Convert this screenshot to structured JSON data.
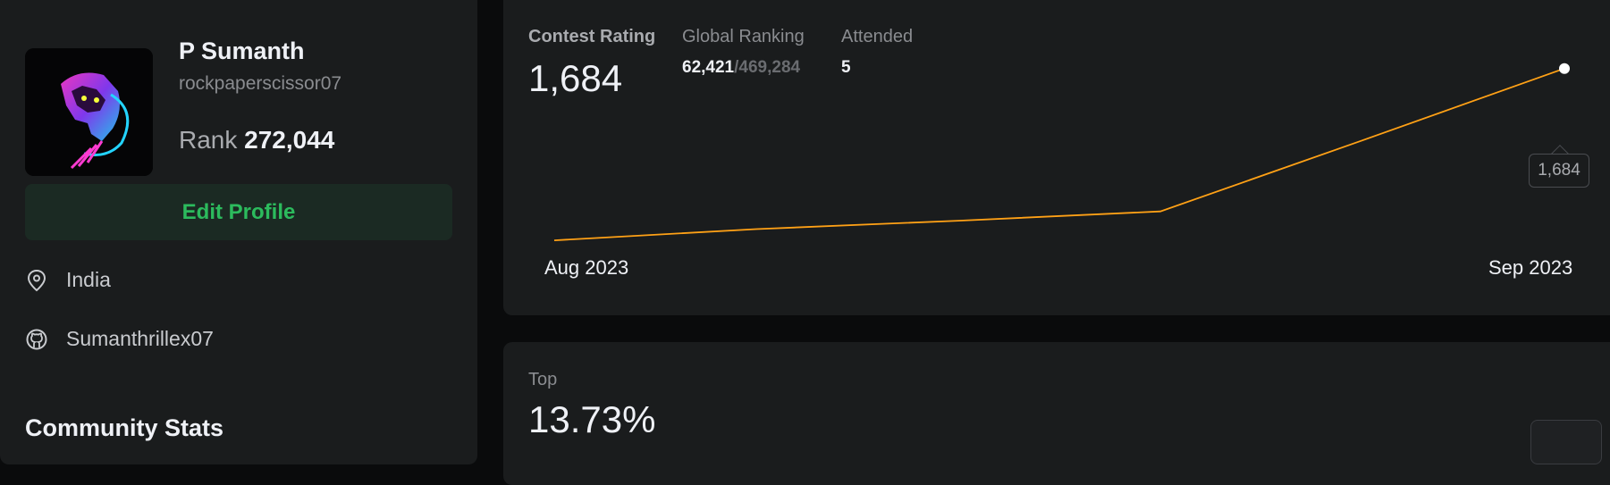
{
  "profile": {
    "display_name": "P Sumanth",
    "username": "rockpaperscissor07",
    "rank_label": "Rank",
    "rank_value": "272,044",
    "edit_button": "Edit Profile",
    "location": "India",
    "github": "Sumanthrillex07",
    "community_stats_heading": "Community Stats"
  },
  "contest": {
    "rating_label": "Contest Rating",
    "rating_value": "1,684",
    "global_ranking_label": "Global Ranking",
    "global_rank": "62,421",
    "global_separator": "/",
    "global_total": "469,284",
    "attended_label": "Attended",
    "attended_value": "5",
    "tooltip_value": "1,684"
  },
  "top": {
    "label": "Top",
    "value": "13.73%"
  },
  "colors": {
    "accent_green": "#2cbb5d",
    "line_orange": "#ffa116",
    "card_bg": "#1a1c1d"
  },
  "icons": {
    "location": "map-pin-icon",
    "github": "github-icon"
  },
  "chart_data": {
    "type": "line",
    "x_tick_labels": [
      "Aug 2023",
      "Sep 2023"
    ],
    "series": [
      {
        "values": [
          1500,
          1512,
          1521,
          1531,
          1607,
          1684
        ]
      }
    ],
    "highlighted_value": 1684,
    "ylim": [
      1480,
      1700
    ],
    "grid": false,
    "legend": "none"
  }
}
